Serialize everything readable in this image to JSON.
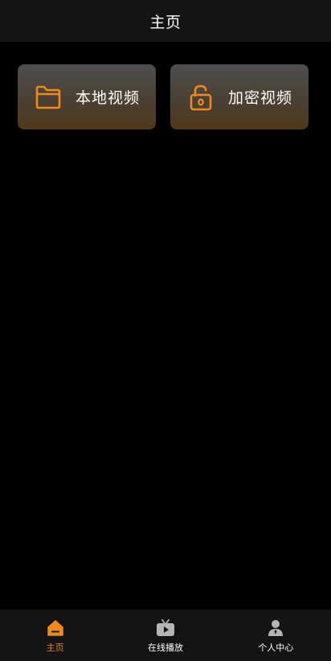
{
  "header": {
    "title": "主页"
  },
  "main": {
    "cards": [
      {
        "label": "本地视频",
        "icon": "folder-icon"
      },
      {
        "label": "加密视频",
        "icon": "unlock-icon"
      }
    ]
  },
  "tabbar": {
    "tabs": [
      {
        "label": "主页",
        "icon": "home-icon",
        "active": true
      },
      {
        "label": "在线播放",
        "icon": "tv-play-icon",
        "active": false
      },
      {
        "label": "个人中心",
        "icon": "user-icon",
        "active": false
      }
    ]
  },
  "colors": {
    "accent": "#f08a1c",
    "background": "#000000",
    "bar": "#141414",
    "inactive_icon": "#b5b5b5"
  }
}
